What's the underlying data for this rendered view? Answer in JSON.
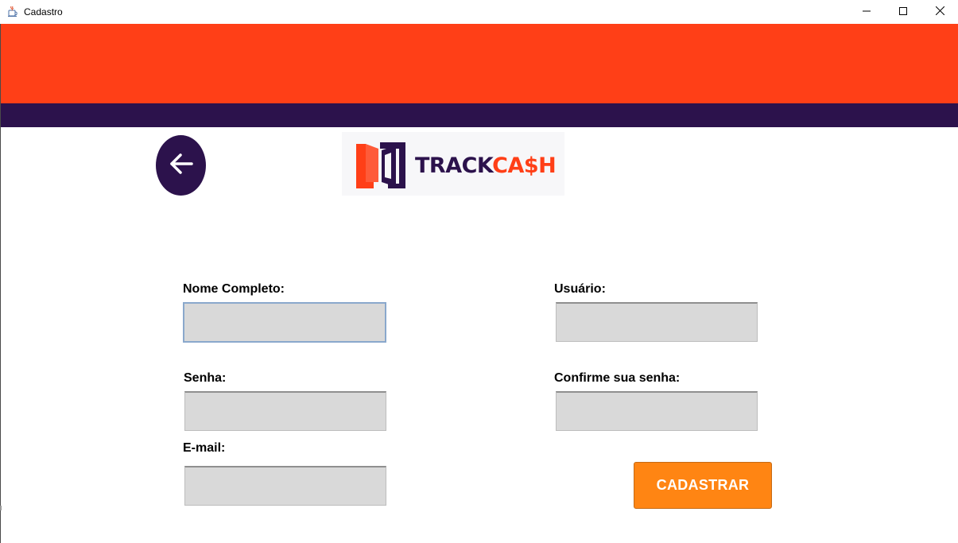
{
  "window": {
    "title": "Cadastro",
    "app_icon": "java-cup-icon",
    "controls": [
      "minimize-icon",
      "maximize-icon",
      "close-icon"
    ]
  },
  "colors": {
    "header_orange": "#ff3f17",
    "header_purple": "#2c124c",
    "input_bg": "#d9d9d9",
    "button_orange": "#ff8513"
  },
  "nav": {
    "back_icon": "arrow-left-icon"
  },
  "logo": {
    "text_part1": "TRACK",
    "text_part2": "CA$H"
  },
  "form": {
    "full_name": {
      "label": "Nome Completo:",
      "value": ""
    },
    "username": {
      "label": "Usuário:",
      "value": ""
    },
    "password": {
      "label": "Senha:",
      "value": ""
    },
    "confirm_password": {
      "label": "Confirme sua senha:",
      "value": ""
    },
    "email": {
      "label": "E-mail:",
      "value": ""
    },
    "submit_label": "CADASTRAR"
  }
}
